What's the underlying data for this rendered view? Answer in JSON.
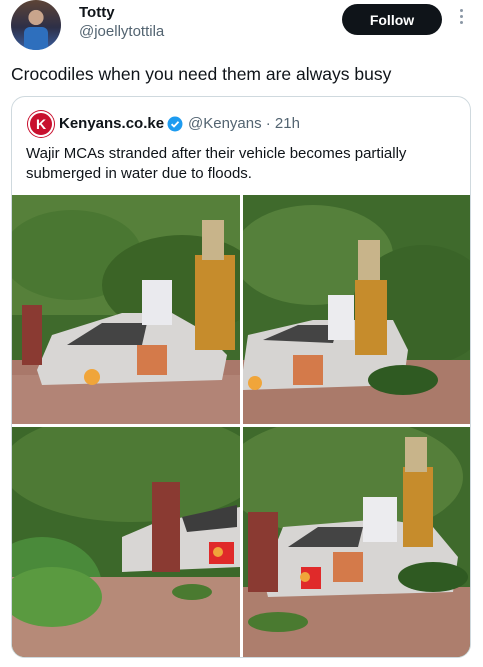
{
  "post": {
    "display_name": "Totty",
    "handle": "@joellytottila",
    "follow_label": "Follow",
    "text": "Crocodiles when you need them are always busy"
  },
  "quote": {
    "logo_letter": "K",
    "name": "Kenyans.co.ke",
    "handle_time": "@Kenyans · 21h",
    "text": "Wajir MCAs stranded after their vehicle becomes partially submerged in water due to floods."
  },
  "icons": {
    "more": "more-options-icon",
    "verified": "verified-badge-icon"
  },
  "colors": {
    "follow_bg": "#0f1419",
    "verified": "#1d9bf0",
    "brand": "#c8102e"
  }
}
